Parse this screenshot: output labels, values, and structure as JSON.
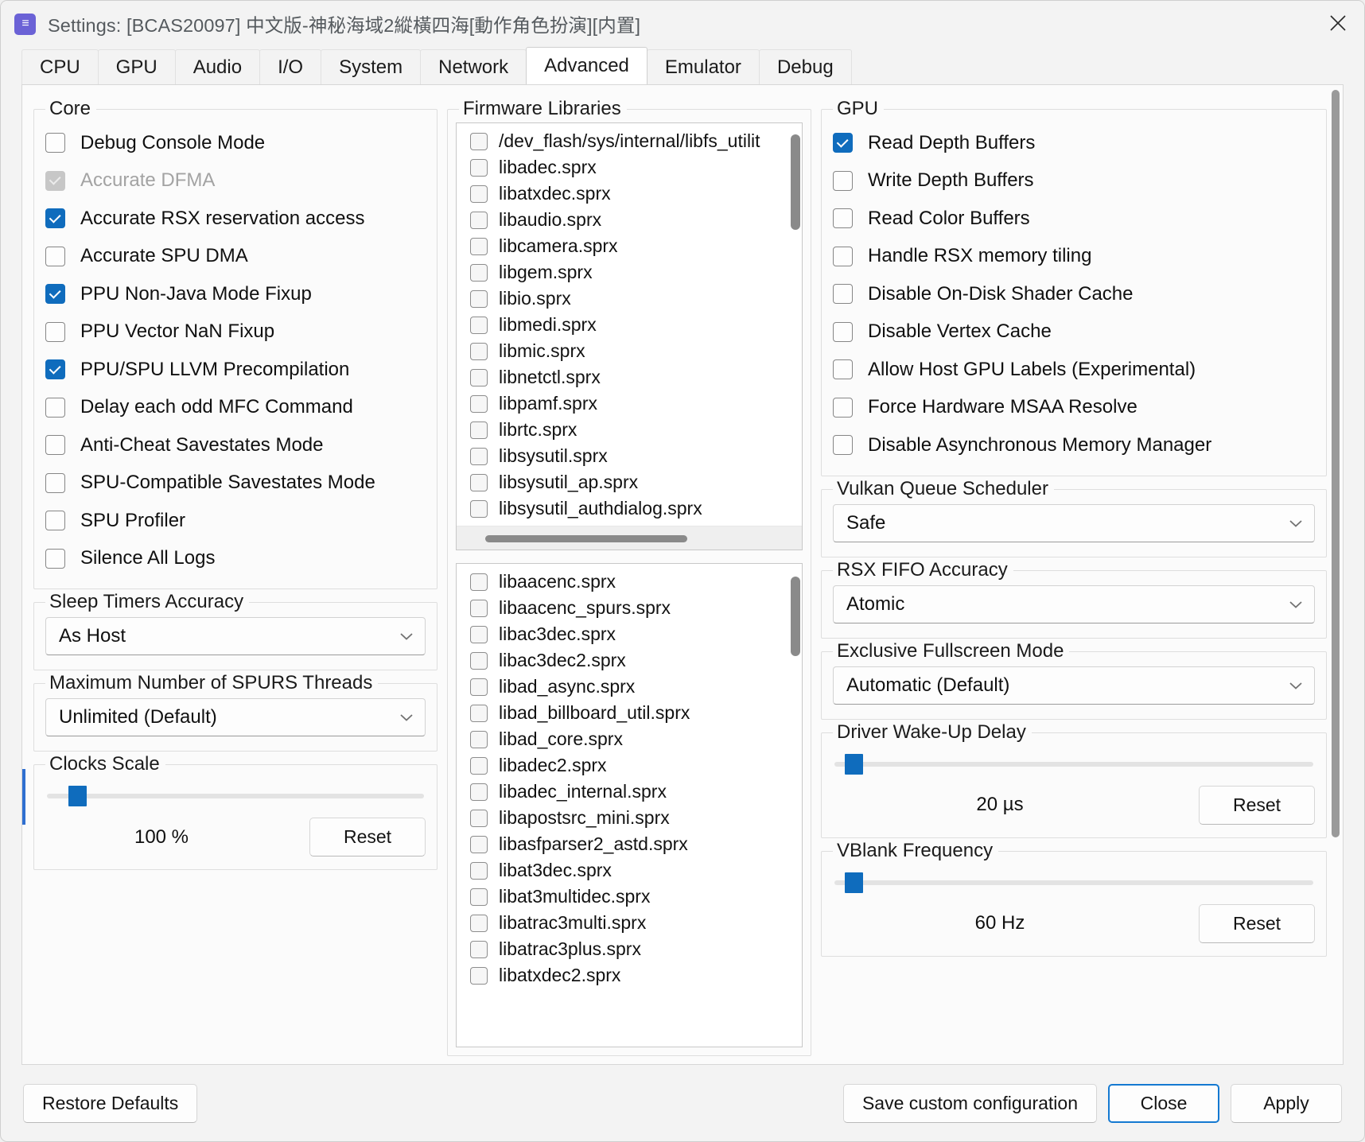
{
  "window": {
    "title": "Settings: [BCAS20097] 中文版-神秘海域2縱橫四海[動作角色扮演][内置]",
    "app_icon": "settings-icon",
    "close_icon": "close-icon",
    "accent_color": "#0f6cbd"
  },
  "tabs": [
    {
      "label": "CPU",
      "active": false
    },
    {
      "label": "GPU",
      "active": false
    },
    {
      "label": "Audio",
      "active": false
    },
    {
      "label": "I/O",
      "active": false
    },
    {
      "label": "System",
      "active": false
    },
    {
      "label": "Network",
      "active": false
    },
    {
      "label": "Advanced",
      "active": true
    },
    {
      "label": "Emulator",
      "active": false
    },
    {
      "label": "Debug",
      "active": false
    }
  ],
  "core": {
    "legend": "Core",
    "checkboxes": [
      {
        "label": "Debug Console Mode",
        "checked": false,
        "disabled": false
      },
      {
        "label": "Accurate DFMA",
        "checked": true,
        "disabled": true
      },
      {
        "label": "Accurate RSX reservation access",
        "checked": true,
        "disabled": false
      },
      {
        "label": "Accurate SPU DMA",
        "checked": false,
        "disabled": false
      },
      {
        "label": "PPU Non-Java Mode Fixup",
        "checked": true,
        "disabled": false
      },
      {
        "label": "PPU Vector NaN Fixup",
        "checked": false,
        "disabled": false
      },
      {
        "label": "PPU/SPU LLVM Precompilation",
        "checked": true,
        "disabled": false
      },
      {
        "label": "Delay each odd MFC Command",
        "checked": false,
        "disabled": false
      },
      {
        "label": "Anti-Cheat Savestates Mode",
        "checked": false,
        "disabled": false
      },
      {
        "label": "SPU-Compatible Savestates Mode",
        "checked": false,
        "disabled": false
      },
      {
        "label": "SPU Profiler",
        "checked": false,
        "disabled": false
      },
      {
        "label": "Silence All Logs",
        "checked": false,
        "disabled": false
      }
    ]
  },
  "sleep_timers": {
    "legend": "Sleep Timers Accuracy",
    "value": "As Host"
  },
  "spurs_threads": {
    "legend": "Maximum Number of SPURS Threads",
    "value": "Unlimited (Default)"
  },
  "clocks_scale": {
    "legend": "Clocks Scale",
    "value_text": "100 %",
    "slider_percent": 9,
    "reset_label": "Reset"
  },
  "firmware_libraries": {
    "legend": "Firmware Libraries",
    "list_top": [
      "/dev_flash/sys/internal/libfs_utilit",
      "libadec.sprx",
      "libatxdec.sprx",
      "libaudio.sprx",
      "libcamera.sprx",
      "libgem.sprx",
      "libio.sprx",
      "libmedi.sprx",
      "libmic.sprx",
      "libnetctl.sprx",
      "libpamf.sprx",
      "librtc.sprx",
      "libsysutil.sprx",
      "libsysutil_ap.sprx",
      "libsysutil_authdialog.sprx"
    ],
    "list_bottom": [
      "libaacenc.sprx",
      "libaacenc_spurs.sprx",
      "libac3dec.sprx",
      "libac3dec2.sprx",
      "libad_async.sprx",
      "libad_billboard_util.sprx",
      "libad_core.sprx",
      "libadec2.sprx",
      "libadec_internal.sprx",
      "libapostsrc_mini.sprx",
      "libasfparser2_astd.sprx",
      "libat3dec.sprx",
      "libat3multidec.sprx",
      "libatrac3multi.sprx",
      "libatrac3plus.sprx",
      "libatxdec2.sprx"
    ]
  },
  "gpu": {
    "legend": "GPU",
    "checkboxes": [
      {
        "label": "Read Depth Buffers",
        "checked": true
      },
      {
        "label": "Write Depth Buffers",
        "checked": false
      },
      {
        "label": "Read Color Buffers",
        "checked": false
      },
      {
        "label": "Handle RSX memory tiling",
        "checked": false
      },
      {
        "label": "Disable On-Disk Shader Cache",
        "checked": false
      },
      {
        "label": "Disable Vertex Cache",
        "checked": false
      },
      {
        "label": "Allow Host GPU Labels (Experimental)",
        "checked": false
      },
      {
        "label": "Force Hardware MSAA Resolve",
        "checked": false
      },
      {
        "label": "Disable Asynchronous Memory Manager",
        "checked": false
      }
    ]
  },
  "vulkan_queue_scheduler": {
    "legend": "Vulkan Queue Scheduler",
    "value": "Safe"
  },
  "rsx_fifo_accuracy": {
    "legend": "RSX FIFO Accuracy",
    "value": "Atomic"
  },
  "exclusive_fullscreen": {
    "legend": "Exclusive Fullscreen Mode",
    "value": "Automatic (Default)"
  },
  "driver_wakeup_delay": {
    "legend": "Driver Wake-Up Delay",
    "value_text": "20 µs",
    "slider_percent": 4,
    "reset_label": "Reset"
  },
  "vblank_frequency": {
    "legend": "VBlank Frequency",
    "value_text": "60 Hz",
    "slider_percent": 4,
    "reset_label": "Reset"
  },
  "footer": {
    "restore_defaults": "Restore Defaults",
    "save_custom_configuration": "Save custom configuration",
    "close": "Close",
    "apply": "Apply"
  }
}
